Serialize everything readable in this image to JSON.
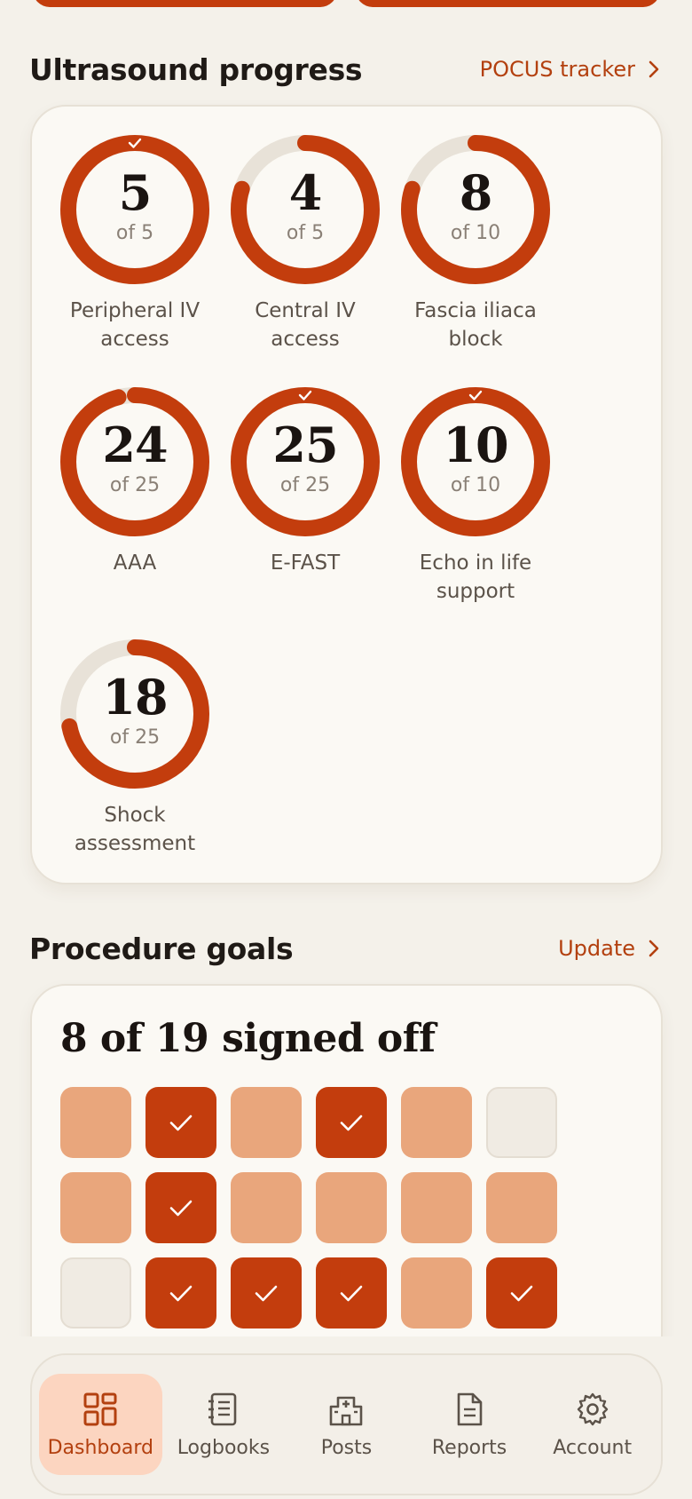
{
  "ultrasound": {
    "title": "Ultrasound progress",
    "link_label": "POCUS tracker",
    "rings": [
      {
        "value": "5",
        "of": "of 5",
        "label_line1": "Peripheral IV",
        "label_line2": "access",
        "progress": 1.0,
        "complete": true
      },
      {
        "value": "4",
        "of": "of 5",
        "label_line1": "Central IV",
        "label_line2": "access",
        "progress": 0.8,
        "complete": false
      },
      {
        "value": "8",
        "of": "of 10",
        "label_line1": "Fascia iliaca",
        "label_line2": "block",
        "progress": 0.8,
        "complete": false
      },
      {
        "value": "24",
        "of": "of 25",
        "label_line1": "AAA",
        "label_line2": "",
        "progress": 0.96,
        "complete": false
      },
      {
        "value": "25",
        "of": "of 25",
        "label_line1": "E-FAST",
        "label_line2": "",
        "progress": 1.0,
        "complete": true
      },
      {
        "value": "10",
        "of": "of 10",
        "label_line1": "Echo in life",
        "label_line2": "support",
        "progress": 1.0,
        "complete": true
      },
      {
        "value": "18",
        "of": "of 25",
        "label_line1": "Shock",
        "label_line2": "assessment",
        "progress": 0.72,
        "complete": false
      }
    ]
  },
  "goals": {
    "title": "Procedure goals",
    "link_label": "Update",
    "summary": "8 of 19 signed off",
    "tiles": [
      "prog",
      "done",
      "prog",
      "done",
      "prog",
      "none",
      "prog",
      "done",
      "prog",
      "prog",
      "prog",
      "prog",
      "none",
      "done",
      "done",
      "done",
      "prog",
      "done"
    ]
  },
  "nav": {
    "items": [
      {
        "label": "Dashboard",
        "icon": "dashboard-icon",
        "active": true
      },
      {
        "label": "Logbooks",
        "icon": "logbook-icon",
        "active": false
      },
      {
        "label": "Posts",
        "icon": "hospital-icon",
        "active": false
      },
      {
        "label": "Reports",
        "icon": "report-icon",
        "active": false
      },
      {
        "label": "Account",
        "icon": "gear-icon",
        "active": false
      }
    ]
  },
  "colors": {
    "accent": "#c33d0d",
    "accent_light": "#e9a67c",
    "track": "#e8e2d8",
    "background": "#f4f1ea"
  }
}
